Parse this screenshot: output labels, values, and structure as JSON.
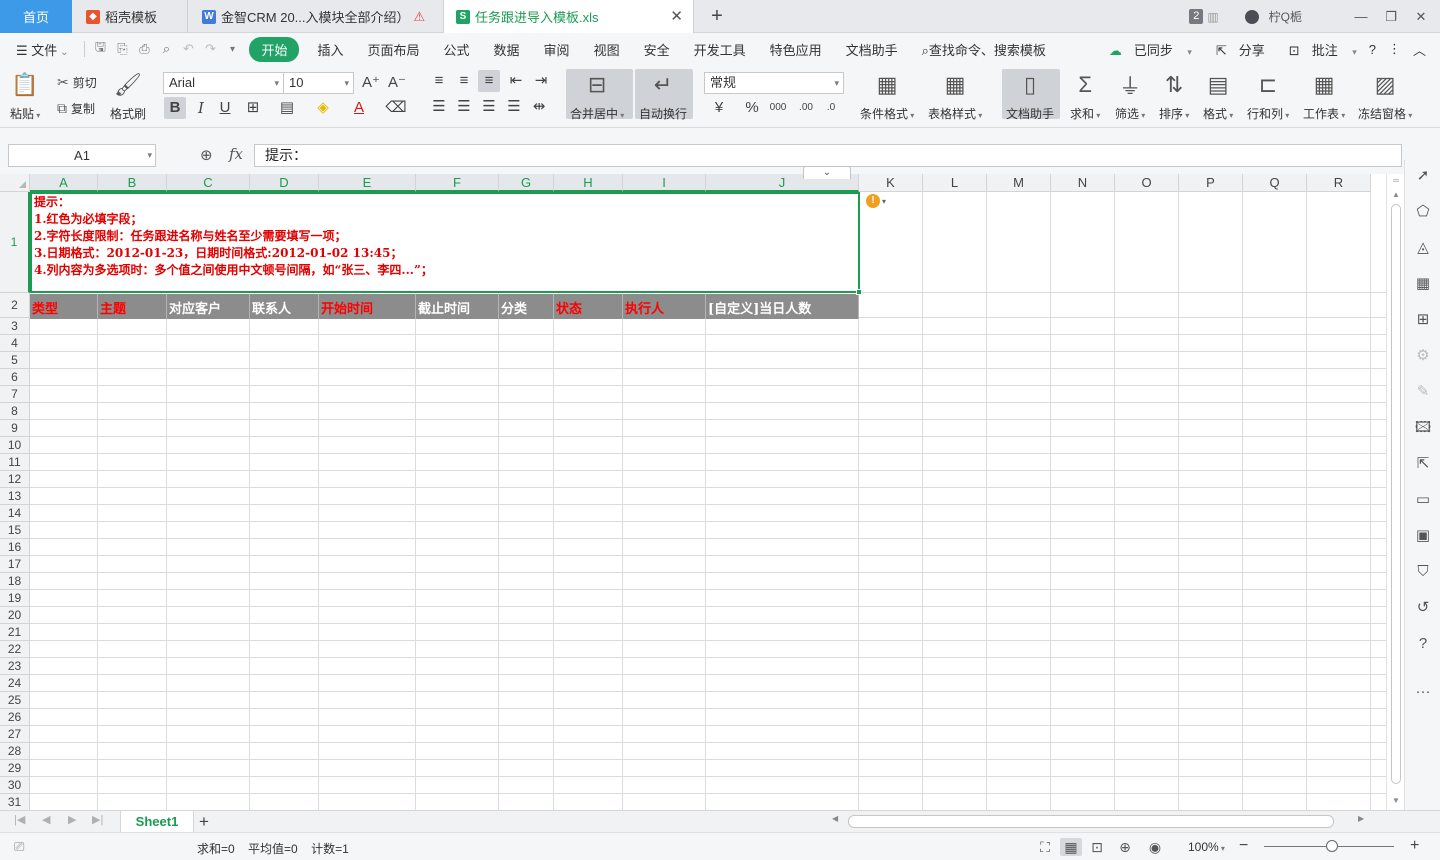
{
  "tabs": {
    "home": "首页",
    "docs": [
      {
        "label": "稻壳模板",
        "icon": "docer-icon",
        "color": "#e8542f"
      },
      {
        "label": "金智CRM 20...入模块全部介绍）",
        "icon": "word-doc-icon",
        "color": "#3f7bd8",
        "warning": "⚠"
      }
    ],
    "active": {
      "label": "任务跟进导入模板.xls",
      "icon": "et-sheet-icon",
      "color": "#21a366"
    },
    "add": "+",
    "badge": "2",
    "user": "柠Q栀",
    "window": {
      "min": "—",
      "restore": "❐",
      "close": "✕"
    }
  },
  "menu": {
    "file": "文件",
    "items": [
      "开始",
      "插入",
      "页面布局",
      "公式",
      "数据",
      "审阅",
      "视图",
      "安全",
      "开发工具",
      "特色应用",
      "文档助手"
    ],
    "search": "查找命令、搜索模板",
    "right": {
      "sync": "已同步",
      "share": "分享",
      "comment": "批注"
    }
  },
  "ribbon": {
    "paste": "粘贴",
    "cut": "剪切",
    "copy": "复制",
    "format_painter": "格式刷",
    "font_name": "Arial",
    "font_size": "10",
    "merge_center": "合并居中",
    "wrap_text": "自动换行",
    "number_format": "常规",
    "cond_format": "条件格式",
    "table_style": "表格样式",
    "doc_assistant": "文档助手",
    "sum": "求和",
    "filter": "筛选",
    "sort": "排序",
    "format": "格式",
    "rowcol": "行和列",
    "worksheet": "工作表",
    "freeze": "冻结窗格",
    "bold": "B",
    "italic": "I",
    "underline": "U",
    "percent": "%",
    "thousands": "000"
  },
  "formula": {
    "cell_ref": "A1",
    "fx": "fx",
    "content": "提示："
  },
  "grid": {
    "columns": [
      "A",
      "B",
      "C",
      "D",
      "E",
      "F",
      "G",
      "H",
      "I",
      "J",
      "K",
      "L",
      "M",
      "N",
      "O",
      "P",
      "Q",
      "R"
    ],
    "rows": [
      "1",
      "2",
      "3",
      "4",
      "5",
      "6",
      "7",
      "8",
      "9",
      "10",
      "11",
      "12",
      "13",
      "14",
      "15",
      "16",
      "17",
      "18",
      "19",
      "20",
      "21",
      "22",
      "23",
      "24",
      "25",
      "26",
      "27",
      "28",
      "29",
      "30",
      "31"
    ],
    "hint_lines": [
      "提示：",
      "1.红色为必填字段；",
      "2.字符长度限制：任务跟进名称与姓名至少需要填写一项；",
      "3.日期格式：2012-01-23，日期时间格式:2012-01-02 13:45；",
      "4.列内容为多选项时：多个值之间使用中文顿号间隔，如“张三、李四...”；"
    ],
    "headers": [
      {
        "label": "类型",
        "required": true
      },
      {
        "label": "主题",
        "required": true
      },
      {
        "label": "对应客户",
        "required": false
      },
      {
        "label": "联系人",
        "required": false
      },
      {
        "label": "开始时间",
        "required": true
      },
      {
        "label": "截止时间",
        "required": false
      },
      {
        "label": "分类",
        "required": false
      },
      {
        "label": "状态",
        "required": true
      },
      {
        "label": "执行人",
        "required": true
      },
      {
        "label": "[自定义]当日人数",
        "required": false
      }
    ],
    "required_color": "#ff0000",
    "header_bg": "#8c8c8c"
  },
  "sheets": {
    "active": "Sheet1",
    "add": "+"
  },
  "status": {
    "sum": "求和=0",
    "avg": "平均值=0",
    "count": "计数=1",
    "zoom": "100%"
  }
}
